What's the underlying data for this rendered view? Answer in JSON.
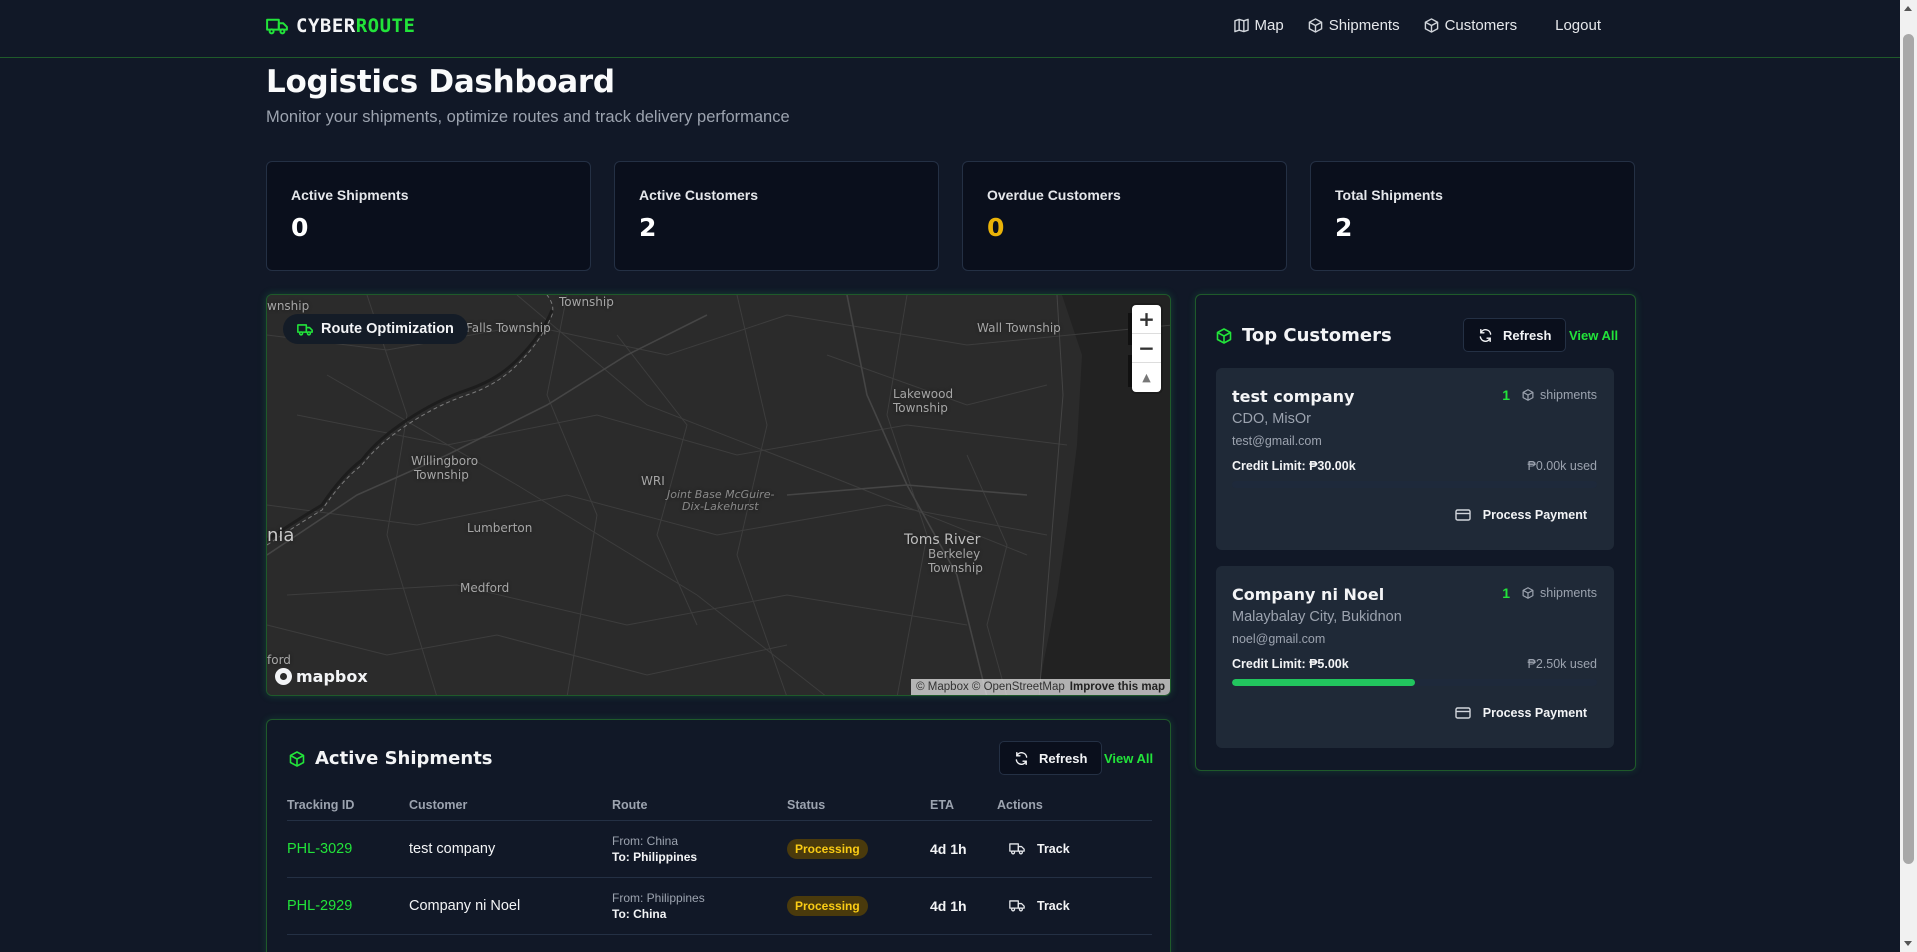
{
  "nav": {
    "brand_prefix": "CYBER",
    "brand_suffix": "ROUTE",
    "links": [
      {
        "label": "Map",
        "icon": "map-icon"
      },
      {
        "label": "Shipments",
        "icon": "box-icon"
      },
      {
        "label": "Customers",
        "icon": "box-icon"
      }
    ],
    "logout_label": "Logout"
  },
  "header": {
    "title": "Logistics Dashboard",
    "subtitle": "Monitor your shipments, optimize routes and track delivery performance"
  },
  "stats": [
    {
      "label": "Active Shipments",
      "value": "0"
    },
    {
      "label": "Active Customers",
      "value": "2"
    },
    {
      "label": "Overdue Customers",
      "value": "0",
      "color": "#eab308"
    },
    {
      "label": "Total Shipments",
      "value": "2"
    }
  ],
  "map": {
    "chip_label": "Route Optimization",
    "zoom_in": "+",
    "zoom_out": "−",
    "compass": "▲",
    "logo_text": "mapbox",
    "attribution": "© Mapbox © OpenStreetMap",
    "improve_label": "Improve this map",
    "places": [
      "wnship",
      "Township",
      "Falls Township",
      "Wall Township",
      "Lakewood",
      "Township",
      "Willingboro",
      "Township",
      "WRI",
      "Joint Base McGuire-",
      "Dix-Lakehurst",
      "Lumberton",
      "Toms River",
      "nia",
      "Medford",
      "Berkeley",
      "Township",
      "ford"
    ]
  },
  "top_customers": {
    "title": "Top Customers",
    "refresh_label": "Refresh",
    "view_all_label": "View All",
    "shipments_word": "shipments",
    "pay_label": "Process Payment",
    "items": [
      {
        "name": "test company",
        "count": "1",
        "location": "CDO, MisOr",
        "email": "test@gmail.com",
        "credit_label": "Credit Limit: ₱30.00k",
        "used_label": "₱0.00k used",
        "used_fraction": 0
      },
      {
        "name": "Company ni Noel",
        "count": "1",
        "location": "Malaybalay City, Bukidnon",
        "email": "noel@gmail.com",
        "credit_label": "Credit Limit: ₱5.00k",
        "used_label": "₱2.50k used",
        "used_fraction": 0.5
      }
    ]
  },
  "active_shipments": {
    "title": "Active Shipments",
    "refresh_label": "Refresh",
    "view_all_label": "View All",
    "columns": [
      "Tracking ID",
      "Customer",
      "Route",
      "Status",
      "ETA",
      "Actions"
    ],
    "track_label": "Track",
    "rows": [
      {
        "id": "PHL-3029",
        "customer": "test company",
        "from": "From: China",
        "to": "To: Philippines",
        "status": "Processing",
        "eta": "4d 1h"
      },
      {
        "id": "PHL-2929",
        "customer": "Company ni Noel",
        "from": "From: Philippines",
        "to": "To: China",
        "status": "Processing",
        "eta": "4d 1h"
      }
    ]
  },
  "colors": {
    "accent": "#22e33a",
    "background": "#111827",
    "card": "#0a0f1c",
    "warning": "#eab308"
  }
}
